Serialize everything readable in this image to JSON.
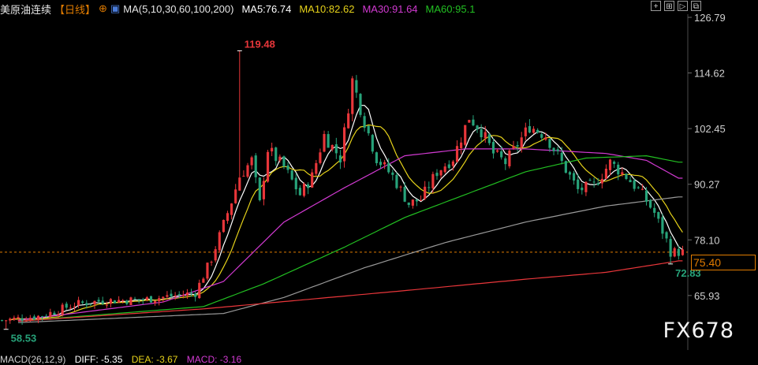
{
  "header": {
    "title": "美原油连续",
    "period": "【日线】",
    "ma_settings": "MA(5,10,30,60,100,200)",
    "ma_values": [
      {
        "label": "MA5:76.74",
        "color": "#ffffff"
      },
      {
        "label": "MA10:82.62",
        "color": "#e6d21a"
      },
      {
        "label": "MA30:91.64",
        "color": "#d23ad2"
      },
      {
        "label": "MA60:95.1",
        "color": "#22c022"
      }
    ],
    "icons": [
      "crosshair-icon",
      "zoom-in-icon",
      "zoom-out-icon",
      "expand-icon"
    ]
  },
  "watermark": "FX678",
  "current_price": "75.40",
  "macd": {
    "label": "MACD(26,12,9)",
    "diff": "DIFF: -5.35",
    "dea": "DEA: -3.67",
    "macd": "MACD: -3.16"
  },
  "chart_data": {
    "type": "candlestick",
    "y_ticks": [
      "126.79",
      "114.62",
      "102.45",
      "90.27",
      "78.10",
      "65.93"
    ],
    "ylim": [
      54.0,
      126.79
    ],
    "annotations": [
      {
        "label": "119.48",
        "value": 119.48,
        "index": 59
      },
      {
        "label": "58.53",
        "value": 58.53,
        "index": 1
      },
      {
        "label": "72.83",
        "value": 72.83,
        "index": 166
      }
    ],
    "current_price": 75.4,
    "colors": {
      "up": "#e8363a",
      "down": "#27a37a",
      "ma5": "#ffffff",
      "ma10": "#e6d21a",
      "ma30": "#d23ad2",
      "ma60": "#22c022",
      "ma100": "#9a9a9a",
      "ma200": "#e8363a",
      "axis": "#cfcfcf",
      "price_line": "#e07b00"
    },
    "close_anchors": [
      [
        0,
        60.5
      ],
      [
        10,
        61.5
      ],
      [
        18,
        64.0
      ],
      [
        25,
        64.8
      ],
      [
        35,
        65.0
      ],
      [
        48,
        66.5
      ],
      [
        52,
        74.0
      ],
      [
        57,
        86.5
      ],
      [
        59,
        92.0
      ],
      [
        62,
        95.5
      ],
      [
        64,
        86.0
      ],
      [
        66,
        98.0
      ],
      [
        70,
        94.0
      ],
      [
        74,
        88.0
      ],
      [
        77,
        92.0
      ],
      [
        80,
        101.0
      ],
      [
        84,
        96.0
      ],
      [
        87,
        113.0
      ],
      [
        90,
        104.0
      ],
      [
        93,
        96.0
      ],
      [
        97,
        92.0
      ],
      [
        101,
        86.0
      ],
      [
        104,
        87.0
      ],
      [
        108,
        93.0
      ],
      [
        112,
        96.0
      ],
      [
        116,
        105.0
      ],
      [
        119,
        102.0
      ],
      [
        122,
        97.0
      ],
      [
        125,
        95.0
      ],
      [
        128,
        99.0
      ],
      [
        131,
        103.0
      ],
      [
        135,
        101.0
      ],
      [
        139,
        95.0
      ],
      [
        143,
        89.0
      ],
      [
        147,
        90.0
      ],
      [
        151,
        95.0
      ],
      [
        155,
        92.0
      ],
      [
        159,
        88.0
      ],
      [
        162,
        84.0
      ],
      [
        165,
        78.0
      ],
      [
        166,
        75.5
      ],
      [
        168,
        75.4
      ]
    ],
    "ma_anchors": {
      "ma30": [
        [
          4,
          60.5
        ],
        [
          40,
          64.5
        ],
        [
          55,
          69.0
        ],
        [
          70,
          82.0
        ],
        [
          85,
          89.5
        ],
        [
          100,
          96.5
        ],
        [
          115,
          98.0
        ],
        [
          130,
          98.0
        ],
        [
          150,
          97.0
        ],
        [
          160,
          95.5
        ],
        [
          168,
          91.6
        ]
      ],
      "ma60": [
        [
          4,
          60.3
        ],
        [
          50,
          63.5
        ],
        [
          65,
          68.5
        ],
        [
          85,
          76.5
        ],
        [
          100,
          83.0
        ],
        [
          115,
          88.0
        ],
        [
          130,
          93.0
        ],
        [
          145,
          96.0
        ],
        [
          160,
          96.5
        ],
        [
          168,
          95.1
        ]
      ],
      "ma100": [
        [
          4,
          60.0
        ],
        [
          55,
          62.0
        ],
        [
          70,
          65.5
        ],
        [
          90,
          72.0
        ],
        [
          110,
          77.5
        ],
        [
          130,
          82.0
        ],
        [
          150,
          85.5
        ],
        [
          168,
          87.5
        ]
      ],
      "ma200": [
        [
          4,
          60.3
        ],
        [
          50,
          63.0
        ],
        [
          75,
          65.0
        ],
        [
          100,
          67.0
        ],
        [
          130,
          69.5
        ],
        [
          150,
          71.0
        ],
        [
          168,
          73.5
        ]
      ]
    }
  }
}
